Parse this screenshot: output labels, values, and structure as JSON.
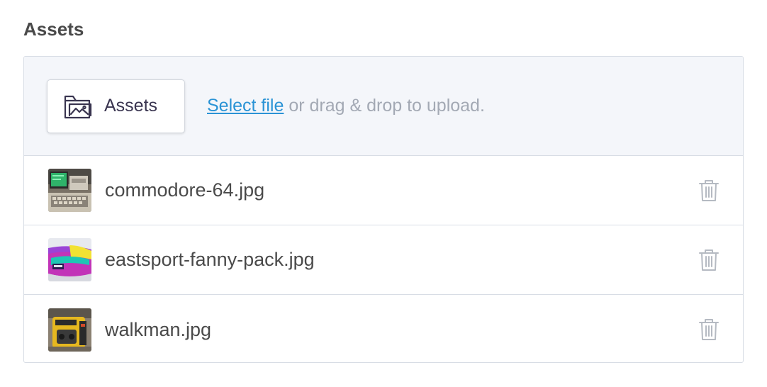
{
  "section": {
    "title": "Assets"
  },
  "upload": {
    "button_label": "Assets",
    "button_icon": "image-folder-icon",
    "link_text": "Select file",
    "hint_text": " or drag & drop to upload."
  },
  "files": [
    {
      "name": "commodore-64.jpg",
      "thumbnail": "commodore-64-thumbnail",
      "action_icon": "trash-icon"
    },
    {
      "name": "eastsport-fanny-pack.jpg",
      "thumbnail": "fanny-pack-thumbnail",
      "action_icon": "trash-icon"
    },
    {
      "name": "walkman.jpg",
      "thumbnail": "walkman-thumbnail",
      "action_icon": "trash-icon"
    }
  ],
  "colors": {
    "link": "#2a93d5",
    "hint": "#a3a9b4",
    "upload_bg": "#f4f6fa",
    "border": "#d8dde5",
    "icon_muted": "#b5bac2"
  }
}
